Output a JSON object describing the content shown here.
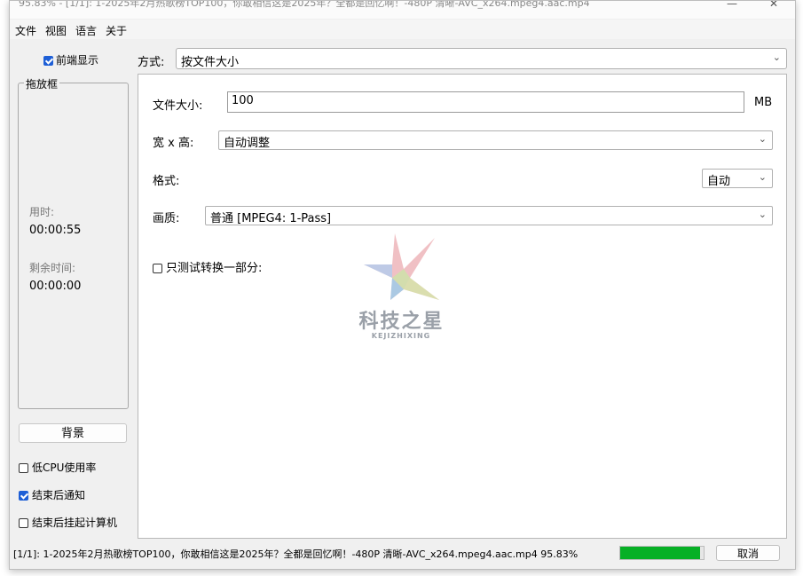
{
  "titlebar": {
    "title": "95.83% - [1/1]: 1-2025年2月热歌榜TOP100，你敢相信这是2025年？全都是回忆啊！-480P 清晰-AVC_x264.mpeg4.aac.mp4",
    "minimize": "—",
    "close": "✕"
  },
  "menu": [
    "文件",
    "视图",
    "语言",
    "关于"
  ],
  "left": {
    "front_display_label": "前端显示",
    "dropbox_label": "拖放框",
    "elapsed_label": "用时:",
    "elapsed_value": "00:00:55",
    "remaining_label": "剩余时间:",
    "remaining_value": "00:00:00",
    "background_button": "背景",
    "options": [
      {
        "label": "低CPU使用率",
        "checked": false
      },
      {
        "label": "结束后通知",
        "checked": true
      },
      {
        "label": "结束后挂起计算机",
        "checked": false
      }
    ]
  },
  "mode": {
    "label": "方式:",
    "value": "按文件大小"
  },
  "main": {
    "filesize_label": "文件大小:",
    "filesize_value": "100",
    "filesize_unit": "MB",
    "resolution_label": "宽 x 高:",
    "resolution_value": "自动调整",
    "format_label": "格式:",
    "format_value": "自动",
    "quality_label": "画质:",
    "quality_value": "普通  [MPEG4: 1-Pass]",
    "test_part_label": "只测试转换一部分:"
  },
  "status": {
    "text": "[1/1]: 1-2025年2月热歌榜TOP100，你敢相信这是2025年？全都是回忆啊！-480P 清晰-AVC_x264.mpeg4.aac.mp4  95.83%",
    "progress": 0.9583,
    "cancel_button": "取消"
  },
  "watermark": {
    "text": "科技之星",
    "subtext": "KEJIZHIXING"
  },
  "colors": {
    "accent": "#1e5fd6",
    "progress_fill": "#06b025",
    "window_bg": "#f0f0f0"
  },
  "icons": [
    "chevron-down-icon",
    "checkbox-icon",
    "star-logo-icon"
  ]
}
